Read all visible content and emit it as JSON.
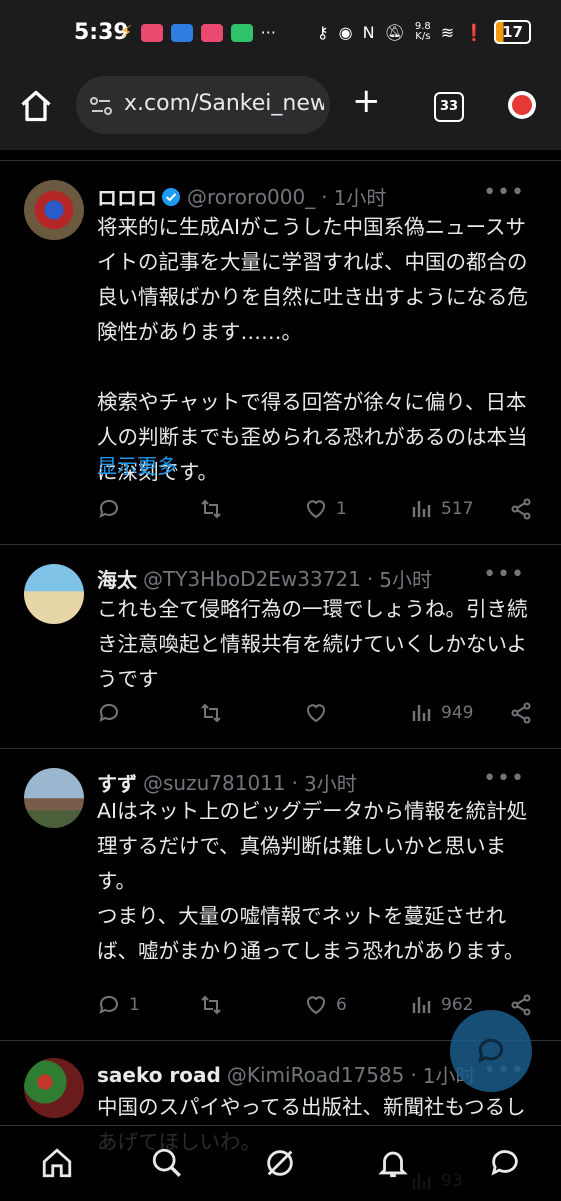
{
  "status_bar": {
    "time": "5:39",
    "network_speed": "9.8\nK/s",
    "battery": "17",
    "icons": [
      "lightning-icon",
      "app-icon",
      "shield-icon",
      "app-icon",
      "wechat-icon",
      "more-dots-icon",
      "key-icon",
      "eye-icon",
      "nfc-icon",
      "mute-icon",
      "wifi-icon",
      "alert-icon",
      "battery-icon"
    ]
  },
  "browser": {
    "url": "x.com/Sankei_new",
    "tab_count": "33",
    "icons": [
      "home-icon",
      "site-settings-icon",
      "plus-icon",
      "tabs-icon",
      "update-icon"
    ]
  },
  "tweets": [
    {
      "name": "ロロロ",
      "verified": true,
      "handle": "@rororo000_",
      "time": "1小时",
      "text": "将来的に生成AIがこうした中国系偽ニュースサイトの記事を大量に学習すれば、中国の都合の良い情報ばかりを自然に吐き出すようになる危険性があります……。\n\n検索やチャットで得る回答が徐々に偏り、日本人の判断までも歪められる恐れがあるのは本当に深刻です。",
      "show_more": "显示更多",
      "replies": "",
      "retweets": "",
      "likes": "1",
      "views": "517"
    },
    {
      "name": "海太",
      "verified": false,
      "handle": "@TY3HboD2Ew33721",
      "time": "5小时",
      "text": "これも全て侵略行為の一環でしょうね。引き続き注意喚起と情報共有を続けていくしかないようです",
      "replies": "",
      "retweets": "",
      "likes": "",
      "views": "949"
    },
    {
      "name": "すず",
      "verified": false,
      "handle": "@suzu781011",
      "time": "3小时",
      "text": "AIはネット上のビッグデータから情報を統計処理するだけで、真偽判断は難しいかと思います。\nつまり、大量の嘘情報でネットを蔓延させれば、嘘がまかり通ってしまう恐れがあります。",
      "replies": "1",
      "retweets": "",
      "likes": "6",
      "views": "962"
    },
    {
      "name": "saeko road",
      "verified": false,
      "handle": "@KimiRoad17585",
      "time": "1小时",
      "text": "中国のスパイやってる出版社、新聞社もつるしあげてほしいわ。",
      "views": "93"
    }
  ],
  "bottom_nav": [
    "home-icon",
    "search-icon",
    "grok-icon",
    "notifications-icon",
    "messages-icon"
  ],
  "colors": {
    "background": "#000000",
    "accent": "#1d9bf0",
    "muted": "#71767b",
    "text": "#e7e9ea"
  }
}
